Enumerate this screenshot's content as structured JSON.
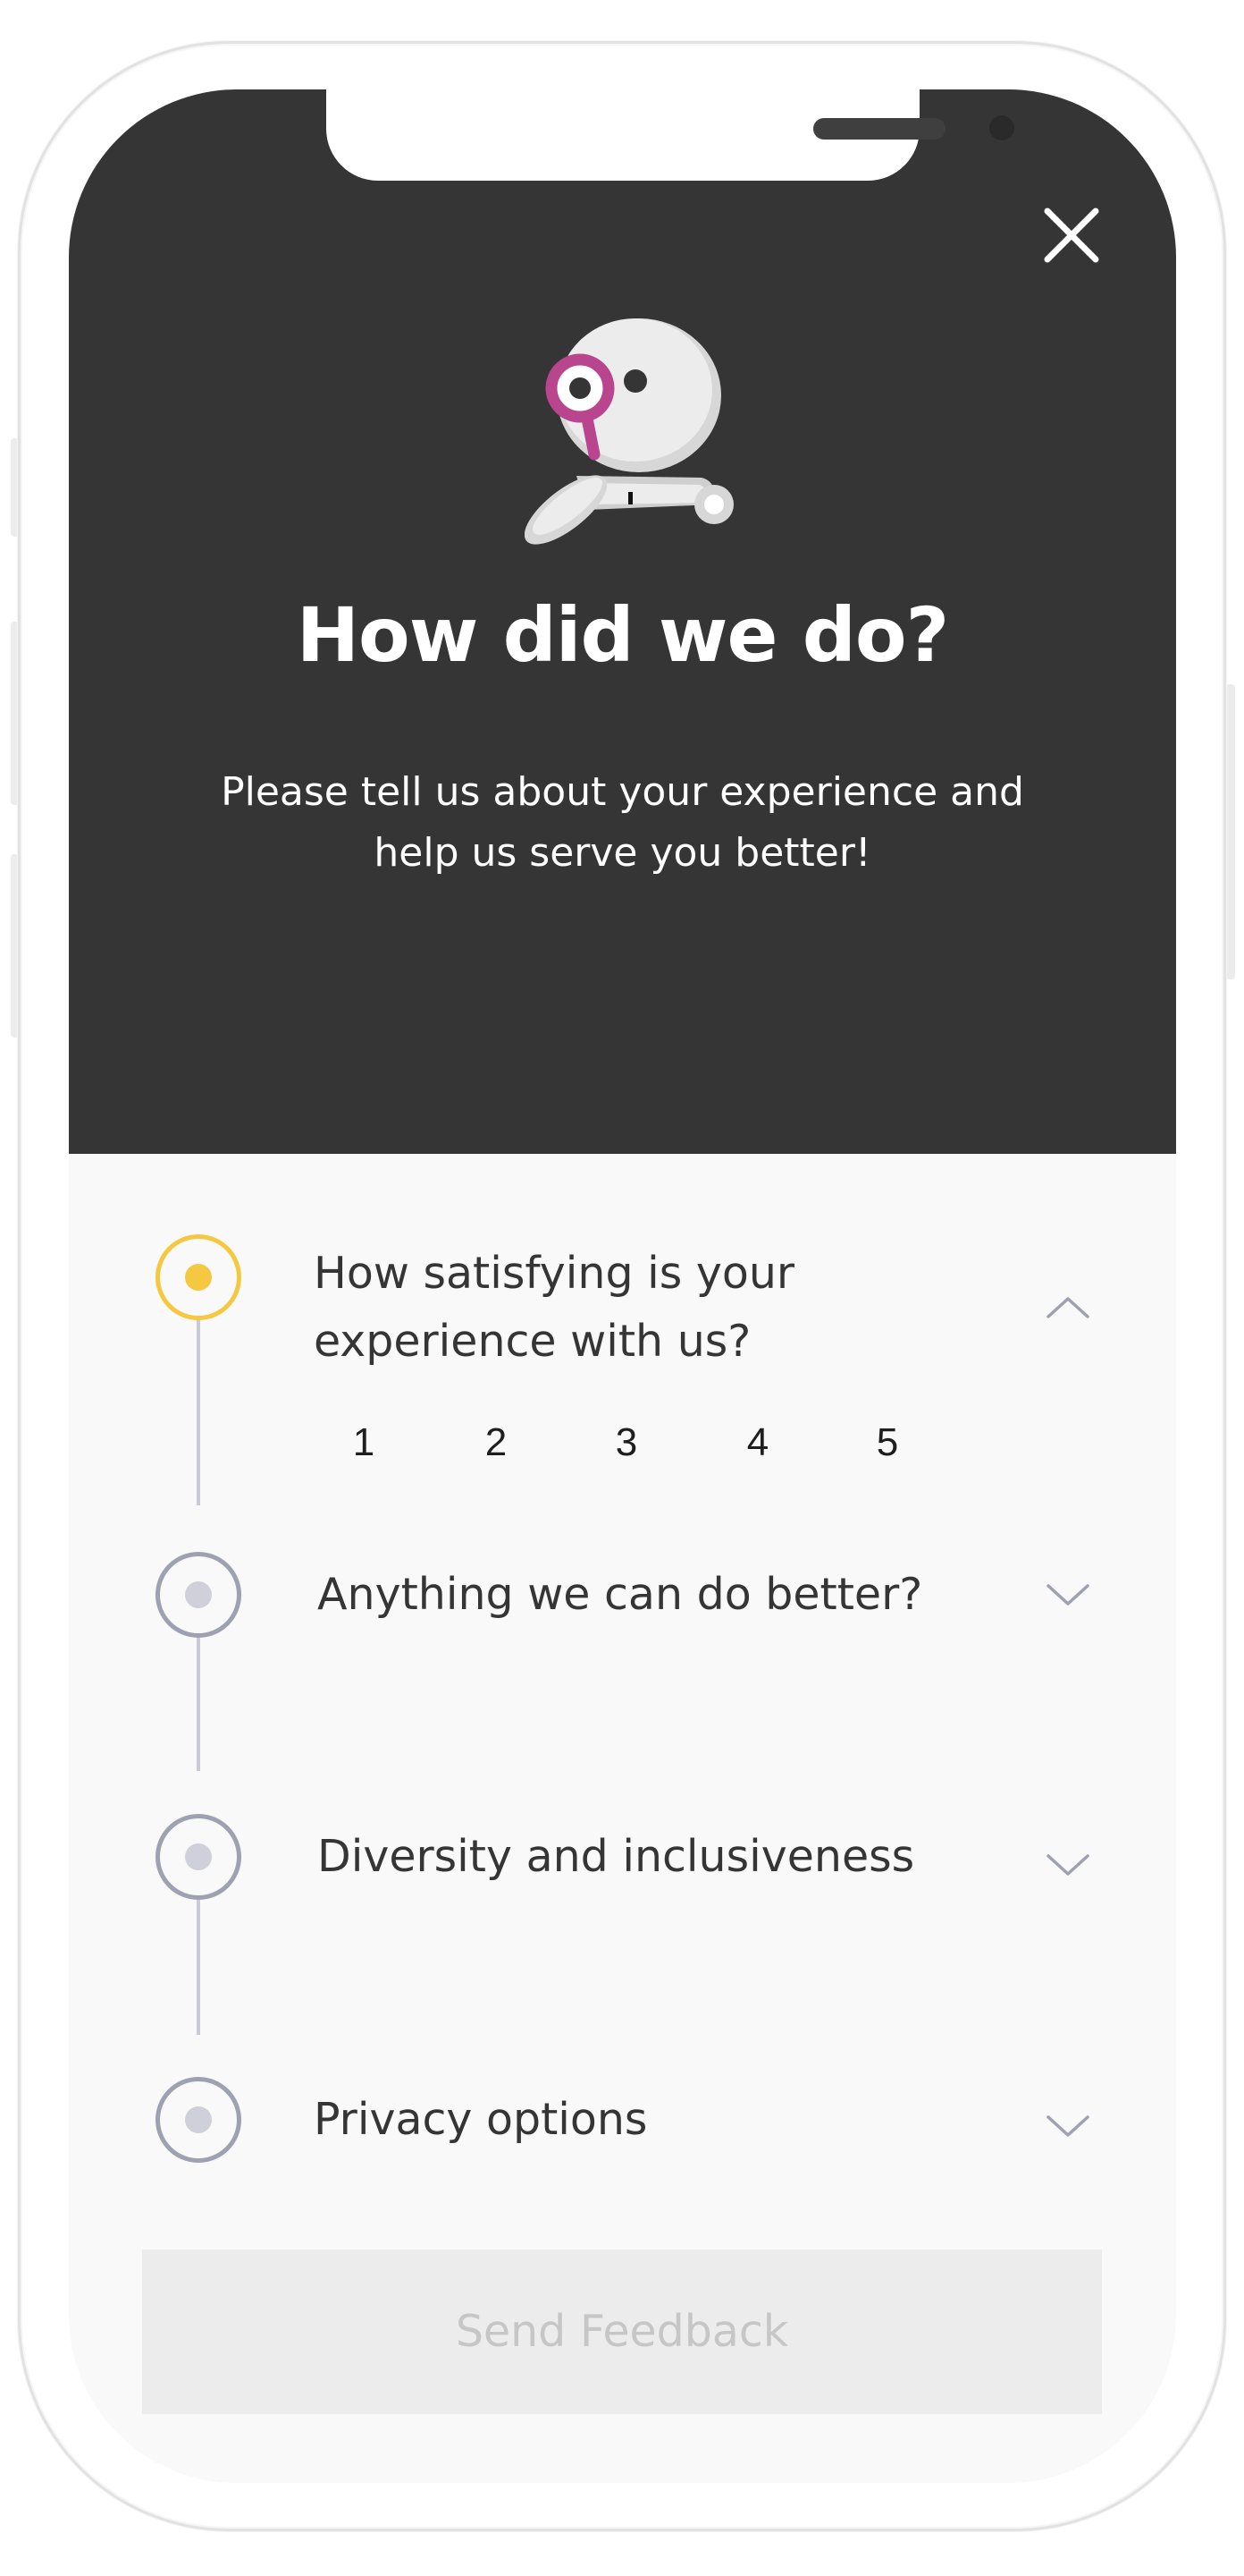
{
  "header": {
    "title": "How did we do?",
    "subtitle": "Please tell us about your experience and help us serve you better!",
    "close_icon": "close-icon",
    "mascot_icon": "robot-mascot-magnifier"
  },
  "steps": [
    {
      "label": "How satisfying is your experience with us?",
      "expanded": true,
      "active": true,
      "rating_options": [
        "1",
        "2",
        "3",
        "4",
        "5"
      ]
    },
    {
      "label": "Anything we can do better?",
      "expanded": false,
      "active": false
    },
    {
      "label": "Diversity and inclusiveness",
      "expanded": false,
      "active": false
    },
    {
      "label": "Privacy options",
      "expanded": false,
      "active": false
    }
  ],
  "footer": {
    "send_label": "Send Feedback",
    "send_enabled": false
  },
  "colors": {
    "header_bg": "#353535",
    "body_bg": "#f9f9f9",
    "accent": "#f5c842",
    "step_inactive": "#9ea1b1",
    "brand_magenta": "#b8458e",
    "button_disabled_bg": "#ececec",
    "button_disabled_text": "#c6c6c6"
  }
}
